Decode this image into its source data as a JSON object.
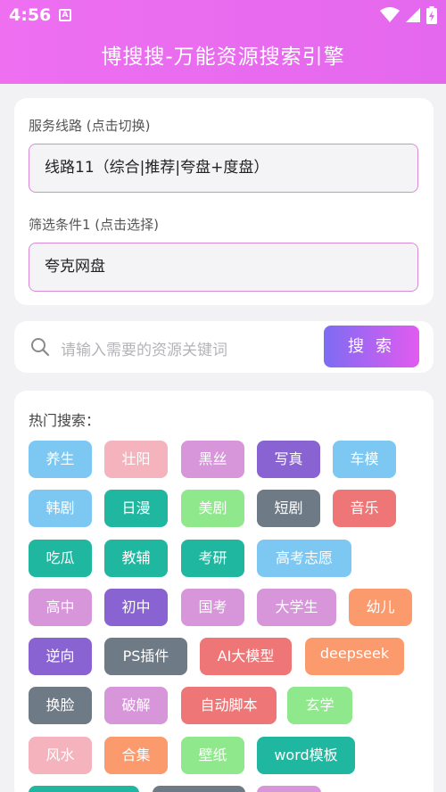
{
  "status": {
    "time": "4:56",
    "sim_badge": "A"
  },
  "header": {
    "title": "博搜搜-万能资源搜索引擎"
  },
  "route": {
    "label": "服务线路 (点击切换)",
    "value": "线路11（综合|推荐|夸盘+度盘）"
  },
  "filter": {
    "label": "筛选条件1 (点击选择)",
    "value": "夸克网盘"
  },
  "search": {
    "placeholder": "请输入需要的资源关键词",
    "button_label": "搜 索"
  },
  "hot": {
    "label": "热门搜索：",
    "tags": [
      {
        "text": "养生",
        "color": "#7dc8f2"
      },
      {
        "text": "壮阳",
        "color": "#f5b3bd"
      },
      {
        "text": "黑丝",
        "color": "#d696d9"
      },
      {
        "text": "写真",
        "color": "#8a63d2"
      },
      {
        "text": "车模",
        "color": "#7dc8f2"
      },
      {
        "text": "韩剧",
        "color": "#7dc8f2"
      },
      {
        "text": "日漫",
        "color": "#1fb7a0"
      },
      {
        "text": "美剧",
        "color": "#8fe88b"
      },
      {
        "text": "短剧",
        "color": "#6e7a86"
      },
      {
        "text": "音乐",
        "color": "#ee7676"
      },
      {
        "text": "吃瓜",
        "color": "#1fb7a0"
      },
      {
        "text": "教辅",
        "color": "#1fb7a0"
      },
      {
        "text": "考研",
        "color": "#1fb7a0"
      },
      {
        "text": "高考志愿",
        "color": "#7dc8f2"
      },
      {
        "text": "高中",
        "color": "#d696d9"
      },
      {
        "text": "初中",
        "color": "#8a63d2"
      },
      {
        "text": "国考",
        "color": "#d696d9"
      },
      {
        "text": "大学生",
        "color": "#d696d9"
      },
      {
        "text": "幼儿",
        "color": "#fb9a6d"
      },
      {
        "text": "逆向",
        "color": "#8a63d2"
      },
      {
        "text": "PS插件",
        "color": "#6e7a86"
      },
      {
        "text": "AI大模型",
        "color": "#ee7676"
      },
      {
        "text": "deepseek",
        "color": "#fb9a6d"
      },
      {
        "text": "换脸",
        "color": "#6e7a86"
      },
      {
        "text": "破解",
        "color": "#d696d9"
      },
      {
        "text": "自动脚本",
        "color": "#ee7676"
      },
      {
        "text": "玄学",
        "color": "#8fe88b"
      },
      {
        "text": "风水",
        "color": "#f5b3bd"
      },
      {
        "text": "合集",
        "color": "#fb9a6d"
      },
      {
        "text": "壁纸",
        "color": "#8fe88b"
      },
      {
        "text": "word模板",
        "color": "#1fb7a0"
      },
      {
        "text": "",
        "color": "#1fb7a0"
      },
      {
        "text": "",
        "color": "#6e7a86"
      },
      {
        "text": "",
        "color": "#d696d9"
      }
    ]
  }
}
